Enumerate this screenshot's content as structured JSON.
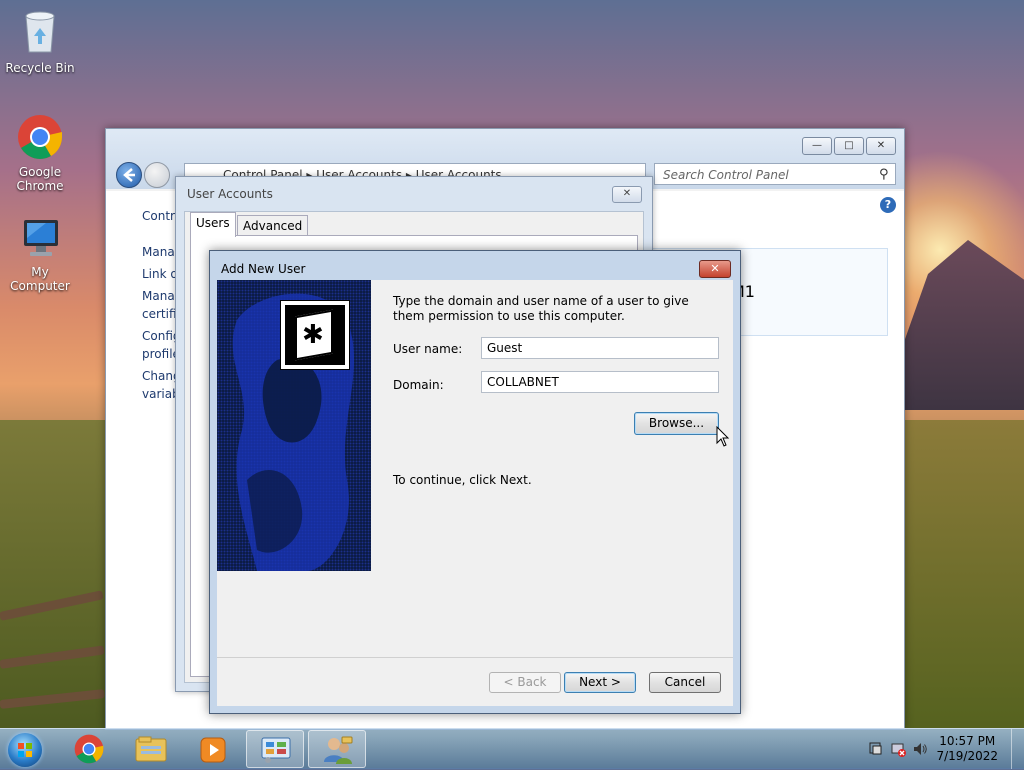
{
  "desktop": {
    "icons": [
      {
        "label": "Recycle Bin",
        "icon": "recycle-bin-icon"
      },
      {
        "label": "Google Chrome",
        "icon": "chrome-icon"
      },
      {
        "label": "My Computer",
        "icon": "computer-icon"
      }
    ]
  },
  "control_panel": {
    "breadcrumb": [
      "Control Panel",
      "User Accounts",
      "User Accounts"
    ],
    "search_placeholder": "Search Control Panel",
    "left_links": [
      "Contro",
      "Manag",
      "Link or",
      "Manag",
      "certifi",
      "Config",
      "profile",
      "Chang",
      "variab"
    ],
    "account_name_partial": "M1"
  },
  "user_accounts": {
    "title": "User Accounts",
    "tabs": [
      "Users",
      "Advanced"
    ]
  },
  "add_new_user": {
    "title": "Add New User",
    "instructions": "Type the domain and user name of a user to give them permission to use this computer.",
    "username_label": "User name:",
    "username_value": "Guest",
    "domain_label": "Domain:",
    "domain_value": "COLLABNET",
    "browse_label": "Browse...",
    "continue_text": "To continue, click Next.",
    "back_label": "< Back",
    "next_label": "Next >",
    "cancel_label": "Cancel"
  },
  "taskbar": {
    "time": "10:57 PM",
    "date": "7/19/2022",
    "items": [
      "start-orb-icon",
      "chrome-icon",
      "explorer-icon",
      "media-player-icon",
      "control-panel-icon",
      "user-accounts-icon"
    ]
  }
}
